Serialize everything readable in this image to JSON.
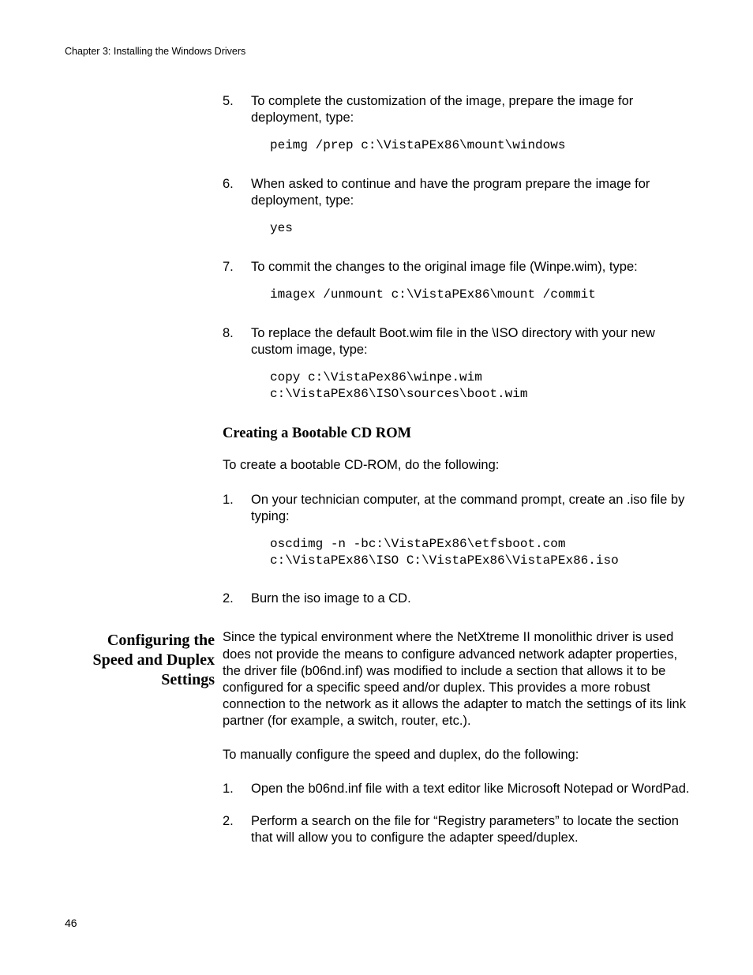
{
  "header": "Chapter 3: Installing the Windows Drivers",
  "page_number": "46",
  "sections": [
    {
      "side_title": "",
      "blocks": [
        {
          "type": "li",
          "num": "5.",
          "text": "To complete the customization of the image, prepare the image for deployment, type:"
        },
        {
          "type": "mono",
          "text": "peimg /prep c:\\VistaPEx86\\mount\\windows"
        },
        {
          "type": "li",
          "num": "6.",
          "text": "When asked to continue and have the program prepare the image for deployment, type:"
        },
        {
          "type": "mono",
          "text": "yes"
        },
        {
          "type": "li",
          "num": "7.",
          "text": "To commit the changes to the original image file (Winpe.wim), type:"
        },
        {
          "type": "mono",
          "text": "imagex /unmount c:\\VistaPEx86\\mount /commit"
        },
        {
          "type": "li",
          "num": "8.",
          "text": "To replace the default Boot.wim file in the \\ISO directory with your new custom image, type:"
        },
        {
          "type": "mono",
          "text": "copy c:\\VistaPex86\\winpe.wim\nc:\\VistaPEx86\\ISO\\sources\\boot.wim"
        },
        {
          "type": "h3",
          "text": "Creating a Bootable CD ROM"
        },
        {
          "type": "para",
          "text": "To create a bootable CD-ROM, do the following:"
        },
        {
          "type": "li",
          "num": "1.",
          "text": "On your technician computer, at the command prompt, create an .iso file by typing:"
        },
        {
          "type": "mono",
          "text": "oscdimg -n -bc:\\VistaPEx86\\etfsboot.com\nc:\\VistaPEx86\\ISO C:\\VistaPEx86\\VistaPEx86.iso"
        },
        {
          "type": "li",
          "num": "2.",
          "text": "Burn the iso image to a CD."
        }
      ]
    },
    {
      "side_title": "Configuring the\nSpeed and Duplex\nSettings",
      "blocks": [
        {
          "type": "para",
          "text": "Since the typical environment where the NetXtreme II monolithic driver is used does not provide the means to configure advanced network adapter properties, the driver file (b06nd.inf) was modified to include a section that allows it to be configured for a specific speed and/or duplex. This provides a more robust connection to the network as it allows the adapter to match the settings of its link partner (for example, a switch, router, etc.)."
        },
        {
          "type": "para",
          "text": "To manually configure the speed and duplex, do the following:"
        },
        {
          "type": "li",
          "num": "1.",
          "text": "Open the b06nd.inf file with a text editor like Microsoft Notepad or WordPad."
        },
        {
          "type": "li",
          "num": "2.",
          "text": "Perform a search on the file for “Registry parameters” to locate the section that will allow you to configure the adapter speed/duplex."
        }
      ]
    }
  ]
}
